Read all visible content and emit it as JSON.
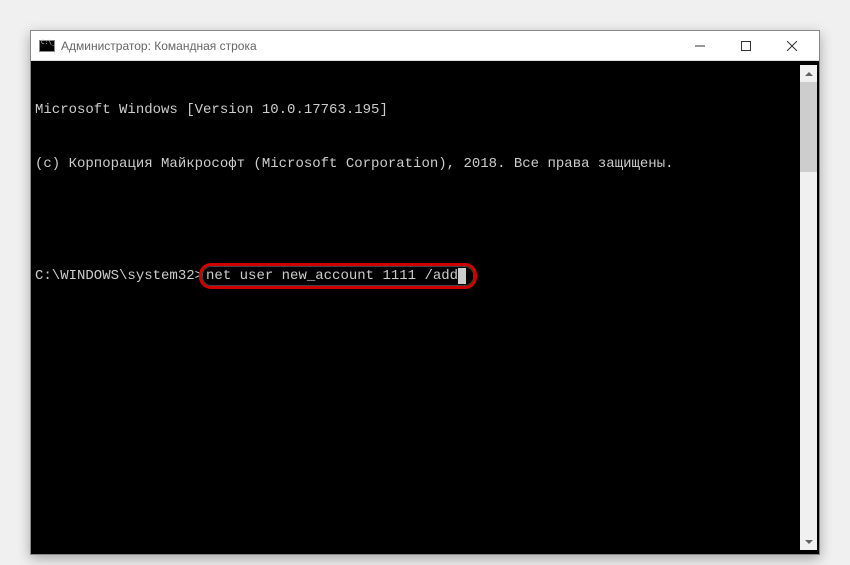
{
  "titlebar": {
    "title": "Администратор: Командная строка"
  },
  "terminal": {
    "line1": "Microsoft Windows [Version 10.0.17763.195]",
    "line2": "(c) Корпорация Майкрософт (Microsoft Corporation), 2018. Все права защищены.",
    "prompt": "C:\\WINDOWS\\system32>",
    "command": "net user new_account 1111 /add"
  },
  "window_controls": {
    "minimize": "—",
    "maximize": "☐",
    "close": "✕"
  }
}
